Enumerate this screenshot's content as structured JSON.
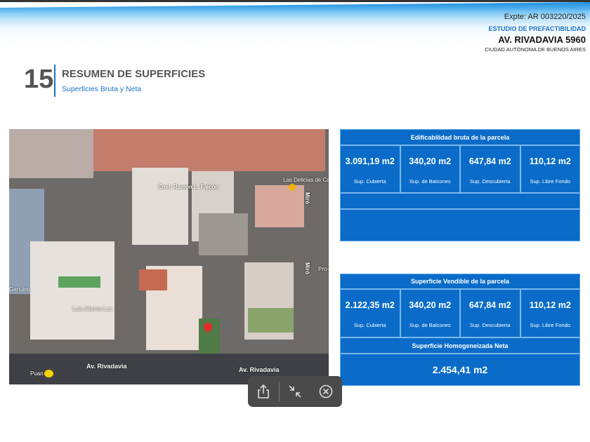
{
  "header": {
    "expediente": "Expte: AR 003220/2025",
    "study": "ESTUDIO DE PREFACTIBILIDAD",
    "address": "AV. RIVADAVIA 5960",
    "city": "CIUDAD AUTÓNOMA DE BUENOS AIRES"
  },
  "section": {
    "number": "15",
    "title": "RESUMEN DE SUPERFICIES",
    "subtitle": "Superficies Bruta y Neta"
  },
  "map": {
    "labels": {
      "street_top": "Cnel. Ramón L. Falcón",
      "poi_top": "Las Delicias de Ca",
      "street_side": "Miró",
      "street_side2": "Miró",
      "poi_right": "Pro-",
      "poi_left": "Genuino",
      "poi_building": "Luis Alberto Lec",
      "avenue_left": "Av. Rivadavia",
      "avenue_right": "Av. Rivadavia",
      "station": "Puan"
    }
  },
  "bruta": {
    "title": "Edificabilidad bruta de la parcela",
    "cells": [
      {
        "value": "3.091,19 m2",
        "label": "Sup. Cubierta"
      },
      {
        "value": "340,20 m2",
        "label": "Sup. de Balcones"
      },
      {
        "value": "647,84 m2",
        "label": "Sup. Descubierta"
      },
      {
        "value": "110,12 m2",
        "label": "Sup. Libre Fondo"
      }
    ]
  },
  "vendible": {
    "title": "Superficie Vendible de la parcela",
    "cells": [
      {
        "value": "2.122,35 m2",
        "label": "Sup. Cubierta"
      },
      {
        "value": "340,20 m2",
        "label": "Sup. de Balcones"
      },
      {
        "value": "647,84 m2",
        "label": "Sup. Descubierta"
      },
      {
        "value": "110,12 m2",
        "label": "Sup. Libre Fondo"
      }
    ],
    "neta_title": "Superficie Homogeneizada Neta",
    "neta_value": "2.454,41 m2"
  },
  "toolbar": {
    "icons": [
      "share-icon",
      "exit-fullscreen-icon",
      "close-circle-icon"
    ]
  }
}
